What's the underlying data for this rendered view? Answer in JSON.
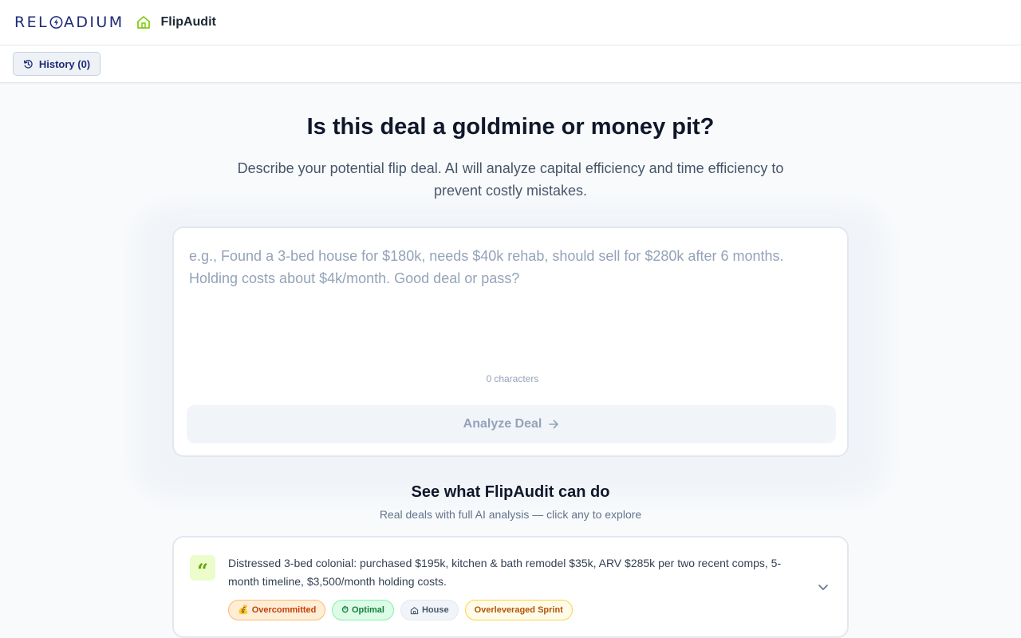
{
  "header": {
    "brand_left": "REL",
    "brand_right": "ADIUM",
    "app_name": "FlipAudit",
    "brand_color": "#1e2a78",
    "accent_color": "#65a30d"
  },
  "toolbar": {
    "history_label": "History (0)"
  },
  "hero": {
    "title": "Is this deal a goldmine or money pit?",
    "subtitle": "Describe your potential flip deal. AI will analyze capital efficiency and time efficiency to prevent costly mistakes."
  },
  "deal_form": {
    "value": "",
    "placeholder": "e.g., Found a 3-bed house for $180k, needs $40k rehab, should sell for $280k after 6 months. Holding costs about $4k/month. Good deal or pass?",
    "char_count": "0",
    "char_count_suffix": "characters",
    "analyze_label": "Analyze Deal"
  },
  "examples": {
    "title": "See what FlipAudit can do",
    "subtitle": "Real deals with full AI analysis — click any to explore",
    "items": [
      {
        "text": "Distressed 3-bed colonial: purchased $195k, kitchen & bath remodel $35k, ARV $285k per two recent comps, 5-month timeline, $3,500/month holding costs.",
        "tags": [
          {
            "icon": "💰",
            "icon_name": "money-bag-icon",
            "label": "Overcommitted",
            "color": "orange"
          },
          {
            "icon": "⏱",
            "icon_name": "stopwatch-icon",
            "label": "Optimal",
            "color": "green"
          },
          {
            "icon": "",
            "icon_name": "house-icon",
            "label": "House",
            "color": "gray"
          },
          {
            "icon": "",
            "icon_name": "",
            "label": "Overleveraged Sprint",
            "color": "yellow"
          }
        ]
      }
    ]
  }
}
